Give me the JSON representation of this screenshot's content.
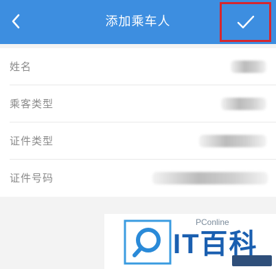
{
  "header": {
    "title": "添加乘车人",
    "back_icon": "chevron-left-icon",
    "confirm_icon": "checkmark-icon"
  },
  "colors": {
    "header_bg": "#3d8ee0",
    "highlight_border": "#d7262d",
    "label_text": "#8a8a8a"
  },
  "form": {
    "rows": [
      {
        "label": "姓名"
      },
      {
        "label": "乘客类型"
      },
      {
        "label": "证件类型"
      },
      {
        "label": "证件号码"
      }
    ]
  },
  "watermark": {
    "brand": "PConline",
    "title": "IT百科",
    "logo_icon": "magnifier-logo-icon"
  }
}
